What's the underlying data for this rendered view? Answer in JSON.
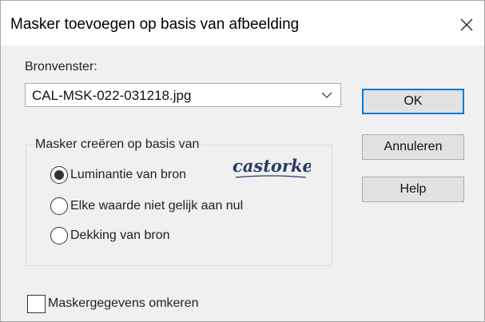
{
  "window": {
    "title": "Masker toevoegen op basis van afbeelding",
    "close_icon": "close-icon"
  },
  "source": {
    "label": "Bronvenster:",
    "selected_value": "CAL-MSK-022-031218.jpg",
    "dropdown_icon": "chevron-down-icon"
  },
  "group": {
    "caption": "Masker creëren op basis van",
    "options": [
      {
        "label": "Luminantie van bron",
        "checked": true
      },
      {
        "label": "Elke waarde niet gelijk aan nul",
        "checked": false
      },
      {
        "label": "Dekking van bron",
        "checked": false
      }
    ]
  },
  "buttons": {
    "ok": "OK",
    "cancel": "Annuleren",
    "help": "Help"
  },
  "invert": {
    "label": "Maskergegevens omkeren",
    "checked": false
  },
  "watermark": {
    "text": "castorke"
  },
  "colors": {
    "default_button_border": "#0078d7",
    "dialog_background": "#f0f0f0"
  }
}
